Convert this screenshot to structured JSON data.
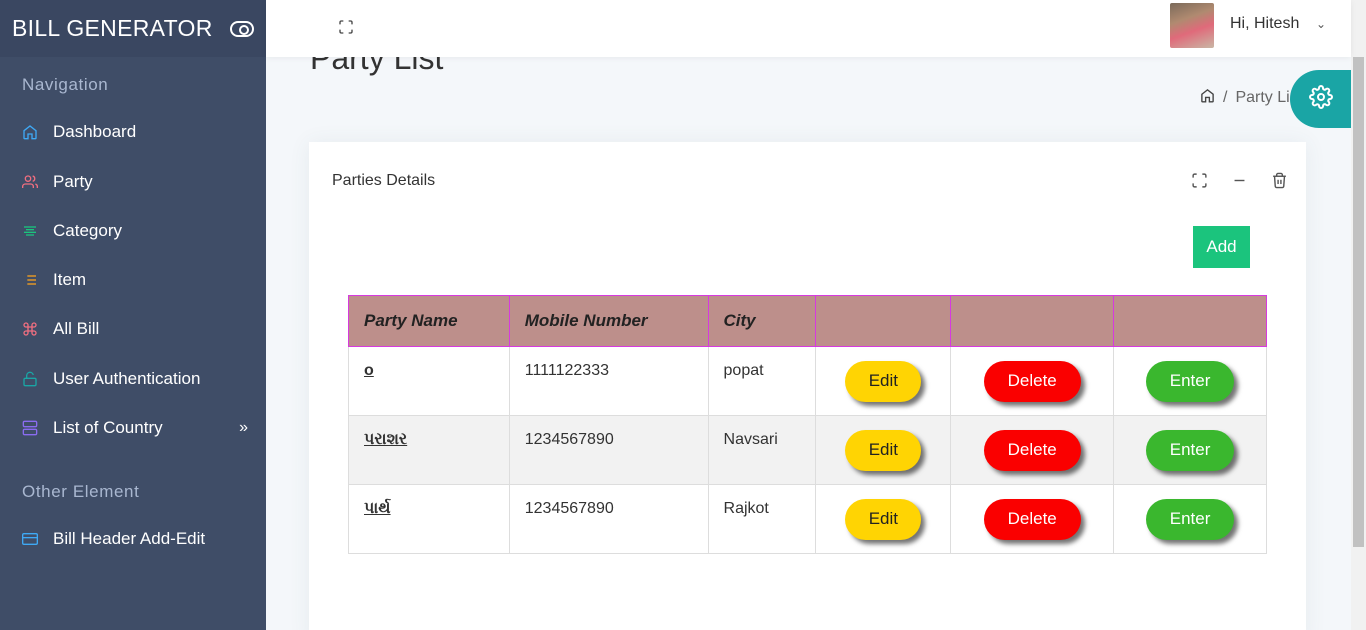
{
  "app": {
    "brand": "BILL GENERATOR"
  },
  "sidebar": {
    "navigation_caption": "Navigation",
    "items": [
      {
        "label": "Dashboard",
        "icon": "home-icon",
        "color": "#3fa9f5"
      },
      {
        "label": "Party",
        "icon": "users-icon",
        "color": "#f16f80"
      },
      {
        "label": "Category",
        "icon": "align-center-icon",
        "color": "#1bc47d"
      },
      {
        "label": "Item",
        "icon": "list-icon",
        "color": "#f4a020"
      },
      {
        "label": "All Bill",
        "icon": "command-icon",
        "color": "#f16f80"
      },
      {
        "label": "User Authentication",
        "icon": "unlock-icon",
        "color": "#1aa5a5"
      },
      {
        "label": "List of Country",
        "icon": "server-icon",
        "color": "#8a6cf0"
      }
    ],
    "other_caption": "Other Element",
    "other_items": [
      {
        "label": "Bill Header Add-Edit",
        "icon": "credit-card-icon",
        "color": "#3fa9f5"
      }
    ],
    "expand_glyph": "»"
  },
  "header": {
    "greeting": "Hi, Hitesh"
  },
  "page": {
    "title": "Party List",
    "breadcrumb": [
      "Party List"
    ]
  },
  "card": {
    "title": "Parties Details",
    "add_label": "Add",
    "columns": [
      "Party Name",
      "Mobile Number",
      "City",
      "",
      "",
      ""
    ],
    "rows": [
      {
        "name": "o",
        "mobile": "1111122333",
        "city": "popat"
      },
      {
        "name": "પરાશર",
        "mobile": "1234567890",
        "city": "Navsari"
      },
      {
        "name": "પાર્થ",
        "mobile": "1234567890",
        "city": "Rajkot"
      }
    ],
    "edit_label": "Edit",
    "delete_label": "Delete",
    "enter_label": "Enter"
  },
  "colors": {
    "sidebar_bg": "#3f4d67",
    "header_row": "#bd8f8b",
    "header_border": "#d63adf",
    "add_button": "#1bc47d",
    "edit_button": "#ffd403",
    "delete_button": "#fa0000",
    "enter_button": "#3ab72e",
    "settings_button": "#1aa5a5"
  }
}
